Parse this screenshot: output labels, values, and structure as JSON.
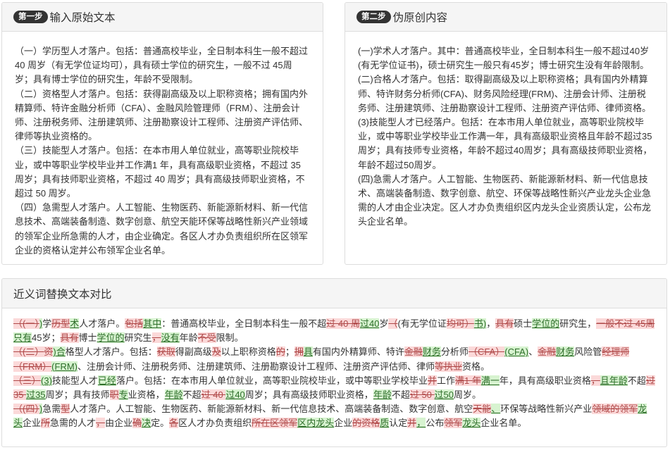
{
  "panels": {
    "original": {
      "step": "第一步",
      "title": "输入原始文本",
      "paragraphs": [
        "（一）学历型人才落户。包括：普通高校毕业，全日制本科生一般不超过 40 周岁（有无学位证均可），具有硕士学位的研究生，一般不过 45周岁；具有博士学位的研究生，年龄不受限制。",
        "（二）资格型人才落户。包括：获得副高级及以上职称资格；拥有国内外精算师、特许金融分析师（CFA）、金融风险管理师（FRM）、注册会计师、注册税务师、注册建筑师、注册勘察设计工程师、注册资产评估师、律师等执业资格的。",
        "（三）技能型人才落户。包括：在本市用人单位就业，高等职业院校毕业，或中等职业学校毕业并工作满1 年，具有高级职业资格，不超过 35 周岁；具有技师职业资格，不超过 40 周岁；具有高级技师职业资格，不超过 50 周岁。",
        "（四）急需型人才落户。人工智能、生物医药、新能源新材料、新一代信息技术、高端装备制造、数字创意、航空天能环保等战略性新兴产业领域的领军企业所急需的人才，由企业确定。各区人才办负责组织所在区领军企业的资格认定并公布领军企业名单。"
      ]
    },
    "rewritten": {
      "step": "第二步",
      "title": "伪原创内容",
      "paragraphs": [
        "(一)学术人才落户。其中：普通高校毕业，全日制本科生一般不超过40岁(有无学位证书)，硕士研究生一般只有45岁；博士研究生没有年龄限制。",
        "(二)合格人才落户。包括：取得副高级及以上职称资格；具有国内外精算师、特许财务分析师(CFA)、财务风险经理(FRM)、注册会计师、注册税务师、注册建筑师、注册勘察设计工程师、注册资产评估师、律师资格。",
        "(3)技能型人才已经落户。包括：在本市用人单位就业，高等职业院校毕业，或中等职业学校毕业工作满一年，具有高级职业资格且年龄不超过35周岁；具有技师专业资格，年龄不超过40周岁；具有高级技师职业资格，年龄不超过50周岁。",
        "(四)急需人才落户。人工智能、生物医药、新能源新材料、新一代信息技术、高端装备制造、数字创意、航空、环保等战略性新兴产业龙头企业急需的人才由企业决定。区人才办负责组织区内龙头企业资质认定，公布龙头企业名单。"
      ]
    },
    "diff": {
      "title": "近义词替换文本对比",
      "paragraphs": [
        [
          {
            "t": "（(一）",
            "k": "del"
          },
          {
            "t": ")",
            "k": "ins"
          },
          {
            "t": "学",
            "k": "eq"
          },
          {
            "t": "历型",
            "k": "del"
          },
          {
            "t": "术",
            "k": "ins"
          },
          {
            "t": "人才落户。",
            "k": "eq"
          },
          {
            "t": "包括",
            "k": "del"
          },
          {
            "t": "其中",
            "k": "ins"
          },
          {
            "t": "：普通高校毕业，全日制本科生一般不超",
            "k": "eq"
          },
          {
            "t": "过 40 周",
            "k": "del"
          },
          {
            "t": "过40",
            "k": "ins"
          },
          {
            "t": "岁",
            "k": "eq"
          },
          {
            "t": "（",
            "k": "del"
          },
          {
            "t": "(有无学位证",
            "k": "eq"
          },
          {
            "t": "均可）",
            "k": "del"
          },
          {
            "t": "书)",
            "k": "ins"
          },
          {
            "t": "，",
            "k": "eq"
          },
          {
            "t": "具有",
            "k": "del"
          },
          {
            "t": "硕士",
            "k": "eq"
          },
          {
            "t": "学位的",
            "k": "ins"
          },
          {
            "t": "研究生，",
            "k": "eq"
          },
          {
            "t": "一般不过 45周",
            "k": "del"
          },
          {
            "t": "只有",
            "k": "ins"
          },
          {
            "t": "45",
            "k": "eq"
          },
          {
            "t": "岁；",
            "k": "eq"
          },
          {
            "t": "具有",
            "k": "del"
          },
          {
            "t": "博士",
            "k": "eq"
          },
          {
            "t": "学位的",
            "k": "ins"
          },
          {
            "t": "研究生",
            "k": "eq"
          },
          {
            "t": "，",
            "k": "del"
          },
          {
            "t": "没有",
            "k": "ins"
          },
          {
            "t": "年龄",
            "k": "eq"
          },
          {
            "t": "不受",
            "k": "del"
          },
          {
            "t": "限制。",
            "k": "eq"
          }
        ],
        [
          {
            "t": "（(二）",
            "k": "del"
          },
          {
            "t": "资",
            "k": "del"
          },
          {
            "t": ")",
            "k": "ins"
          },
          {
            "t": "合",
            "k": "ins"
          },
          {
            "t": "格型",
            "k": "eq"
          },
          {
            "t": "人才落户。包括：",
            "k": "eq"
          },
          {
            "t": "获取",
            "k": "del"
          },
          {
            "t": "得副高级",
            "k": "eq"
          },
          {
            "t": "及",
            "k": "del"
          },
          {
            "t": "以上职称资格",
            "k": "eq"
          },
          {
            "t": "的",
            "k": "del"
          },
          {
            "t": "；",
            "k": "eq"
          },
          {
            "t": "拥",
            "k": "del"
          },
          {
            "t": "具",
            "k": "ins"
          },
          {
            "t": "有国内外精算师、特许",
            "k": "eq"
          },
          {
            "t": "金融",
            "k": "del"
          },
          {
            "t": "财务",
            "k": "ins"
          },
          {
            "t": "分析师",
            "k": "eq"
          },
          {
            "t": "（CFA）",
            "k": "del"
          },
          {
            "t": "(CFA)",
            "k": "ins"
          },
          {
            "t": "、",
            "k": "eq"
          },
          {
            "t": "金融",
            "k": "del"
          },
          {
            "t": "财务",
            "k": "ins"
          },
          {
            "t": "风险管",
            "k": "eq"
          },
          {
            "t": "经理",
            "k": "del"
          },
          {
            "t": "师（FRM）",
            "k": "del"
          },
          {
            "t": "(FRM)",
            "k": "ins"
          },
          {
            "t": "、注册会计师、注册税务师、注册建筑师、注册勘察设计工程师、注册资产评估师、律师",
            "k": "eq"
          },
          {
            "t": "等执业",
            "k": "del"
          },
          {
            "t": "资格。",
            "k": "eq"
          }
        ],
        [
          {
            "t": "（三）",
            "k": "del"
          },
          {
            "t": "(3)",
            "k": "ins"
          },
          {
            "t": "技能型人才",
            "k": "eq"
          },
          {
            "t": "已经",
            "k": "ins"
          },
          {
            "t": "落户。包括：在本市用人单位就业，高等职业院校毕业，或中等职业学校毕业",
            "k": "eq"
          },
          {
            "t": "并",
            "k": "del"
          },
          {
            "t": "工作",
            "k": "eq"
          },
          {
            "t": "满1 年",
            "k": "del"
          },
          {
            "t": "满一",
            "k": "ins"
          },
          {
            "t": "年，具有高级职业资格",
            "k": "eq"
          },
          {
            "t": "，",
            "k": "del"
          },
          {
            "t": "且年龄",
            "k": "ins"
          },
          {
            "t": "不超",
            "k": "eq"
          },
          {
            "t": "过 35 ",
            "k": "del"
          },
          {
            "t": "过35",
            "k": "ins"
          },
          {
            "t": "周岁；具有技师",
            "k": "eq"
          },
          {
            "t": "职",
            "k": "del"
          },
          {
            "t": "专",
            "k": "ins"
          },
          {
            "t": "业资格，",
            "k": "eq"
          },
          {
            "t": "年龄",
            "k": "ins"
          },
          {
            "t": "不超",
            "k": "eq"
          },
          {
            "t": "过 40 ",
            "k": "del"
          },
          {
            "t": "过40",
            "k": "ins"
          },
          {
            "t": "周岁；具有高级技师职业资格，",
            "k": "eq"
          },
          {
            "t": "年龄",
            "k": "ins"
          },
          {
            "t": "不超",
            "k": "eq"
          },
          {
            "t": "过 50 ",
            "k": "del"
          },
          {
            "t": "过50",
            "k": "ins"
          },
          {
            "t": "周岁。",
            "k": "eq"
          }
        ],
        [
          {
            "t": "（(四）",
            "k": "del"
          },
          {
            "t": ")",
            "k": "ins"
          },
          {
            "t": "急需",
            "k": "eq"
          },
          {
            "t": "型",
            "k": "del"
          },
          {
            "t": "人才落户。人工智能、生物医药、新能源新材料、新一代信息技术、高端装备制造、数字创意、航空",
            "k": "eq"
          },
          {
            "t": "天能",
            "k": "del"
          },
          {
            "t": "、",
            "k": "ins"
          },
          {
            "t": "环保等战略性新兴产业",
            "k": "eq"
          },
          {
            "t": "领域的领军",
            "k": "del"
          },
          {
            "t": "龙头",
            "k": "ins"
          },
          {
            "t": "企业",
            "k": "eq"
          },
          {
            "t": "所",
            "k": "del"
          },
          {
            "t": "急需的人才",
            "k": "eq"
          },
          {
            "t": "，",
            "k": "del"
          },
          {
            "t": "由企业",
            "k": "eq"
          },
          {
            "t": "确",
            "k": "del"
          },
          {
            "t": "决",
            "k": "ins"
          },
          {
            "t": "定。",
            "k": "eq"
          },
          {
            "t": "各",
            "k": "del"
          },
          {
            "t": "区人才办负责组织",
            "k": "eq"
          },
          {
            "t": "所在区领军",
            "k": "del"
          },
          {
            "t": "区内龙头",
            "k": "ins"
          },
          {
            "t": "企业",
            "k": "eq"
          },
          {
            "t": "的",
            "k": "del"
          },
          {
            "t": "资格",
            "k": "del"
          },
          {
            "t": "质",
            "k": "ins"
          },
          {
            "t": "认定",
            "k": "eq"
          },
          {
            "t": "并",
            "k": "del"
          },
          {
            "t": "，",
            "k": "ins"
          },
          {
            "t": "公布",
            "k": "eq"
          },
          {
            "t": "领军",
            "k": "del"
          },
          {
            "t": "龙头",
            "k": "ins"
          },
          {
            "t": "企业名单。",
            "k": "eq"
          }
        ]
      ]
    }
  },
  "colors": {
    "deleted_bg": "#fbd9d9",
    "inserted_bg": "#d7f3d0",
    "badge_bg": "#333333"
  }
}
